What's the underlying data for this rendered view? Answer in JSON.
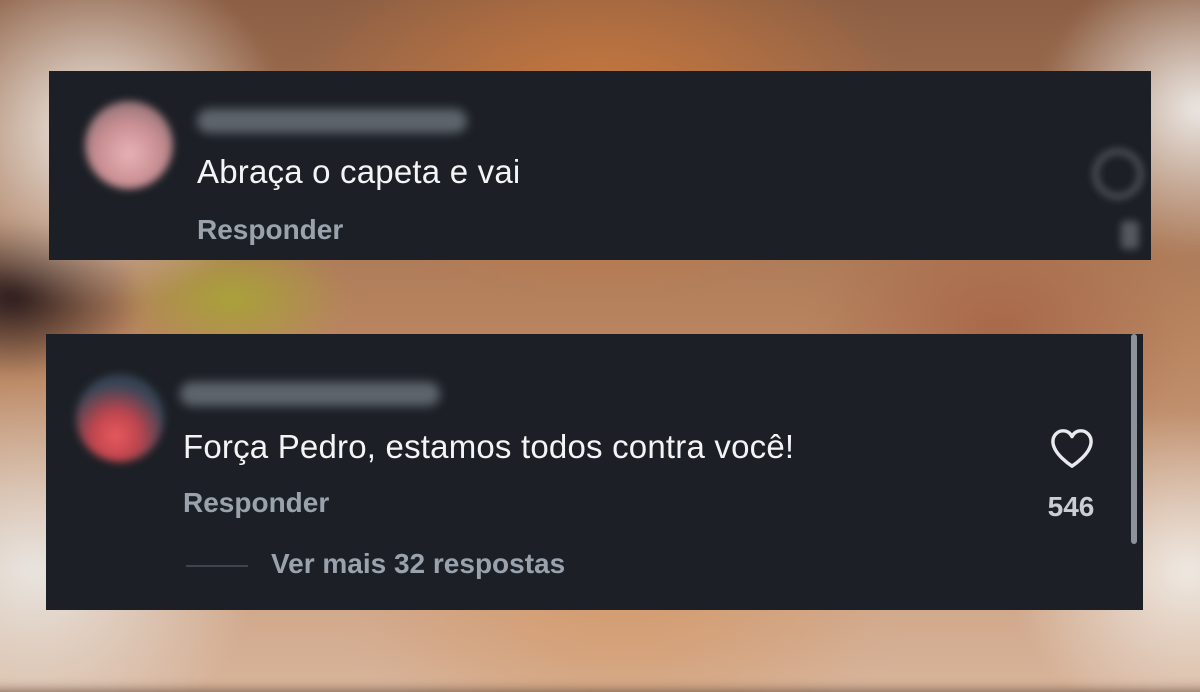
{
  "comments": [
    {
      "text": "Abraça o capeta e vai",
      "reply_label": "Responder"
    },
    {
      "text": "Força Pedro, estamos todos contra você!",
      "reply_label": "Responder",
      "likes": "546",
      "view_more_label": "Ver mais 32 respostas"
    }
  ],
  "colors": {
    "card_background": "#1c2026",
    "text_primary": "#f3f4f6",
    "text_secondary": "#9aa3ad"
  },
  "icons": [
    "heart-icon"
  ]
}
